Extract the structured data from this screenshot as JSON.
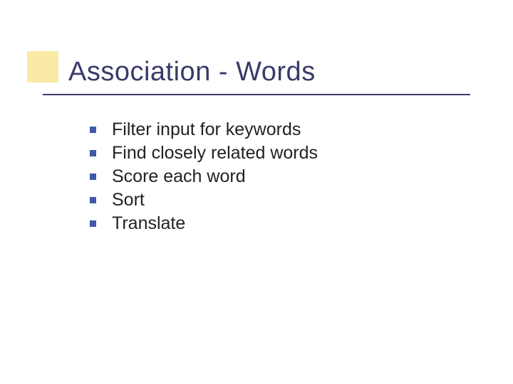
{
  "title": "Association - Words",
  "bullets": [
    "Filter input for keywords",
    "Find closely related words",
    "Score each word",
    "Sort",
    "Translate"
  ]
}
